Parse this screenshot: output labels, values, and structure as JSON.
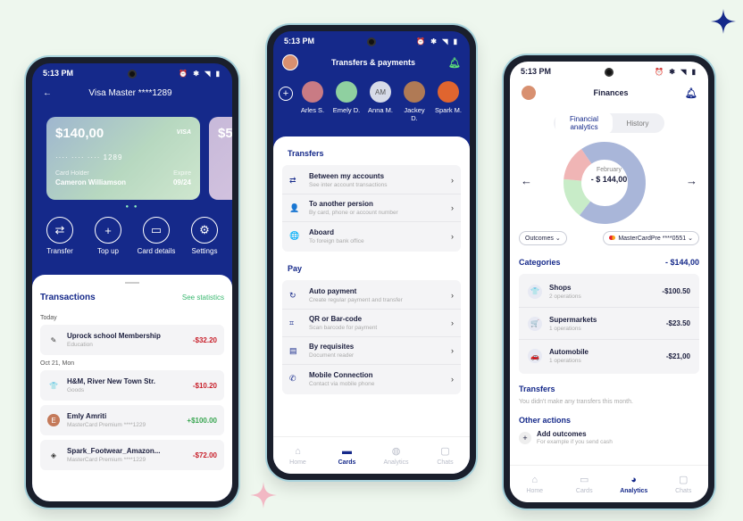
{
  "colors": {
    "accent": "#15298a",
    "positive": "#3aa652",
    "negative": "#c8202b",
    "background": "#eef7ee"
  },
  "phone1": {
    "status_time": "5:13 PM",
    "header_title": "Visa Master ****1289",
    "card": {
      "balance": "$140,00",
      "brand": "VISA",
      "number": "····  ····  ····  1289",
      "holder_label": "Card Holder",
      "holder": "Cameron Williamson",
      "expire_label": "Expire",
      "expire": "09/24"
    },
    "card2_partial": "$5",
    "actions": [
      {
        "label": "Transfer",
        "icon": "transfer-icon",
        "glyph": "⇄"
      },
      {
        "label": "Top up",
        "icon": "plus-icon",
        "glyph": "+"
      },
      {
        "label": "Card details",
        "icon": "card-icon",
        "glyph": "▭"
      },
      {
        "label": "Settings",
        "icon": "gear-icon",
        "glyph": "⚙"
      }
    ],
    "transactions_title": "Transactions",
    "see_statistics": "See statistics",
    "groups": [
      {
        "date": "Today",
        "items": [
          {
            "name": "Uprock school Membership",
            "sub": "Education",
            "amount": "-$32.20",
            "glyph": "✎"
          }
        ]
      },
      {
        "date": "Oct 21, Mon",
        "items": [
          {
            "name": "H&M, River New Town Str.",
            "sub": "Goods",
            "amount": "-$10.20",
            "glyph": "👕"
          },
          {
            "name": "Emly Amriti",
            "sub": "MasterCard Premium ****1229",
            "amount": "+$100.00",
            "glyph": "E"
          },
          {
            "name": "Spark_Footwear_Amazon...",
            "sub": "MasterCard Premium ****1229",
            "amount": "-$72.00",
            "glyph": "◈"
          }
        ]
      }
    ]
  },
  "phone2": {
    "status_time": "5:13 PM",
    "header_title": "Transfers & payments",
    "contacts": [
      {
        "name": "Arles S.",
        "color": "#c97b84",
        "initials": ""
      },
      {
        "name": "Emely D.",
        "color": "#8fd0a0",
        "initials": ""
      },
      {
        "name": "Anna M.",
        "color": "#d7dbe8",
        "initials": "AM"
      },
      {
        "name": "Jackey D.",
        "color": "#b07a55",
        "initials": ""
      },
      {
        "name": "Spark M.",
        "color": "#e0652f",
        "initials": ""
      }
    ],
    "transfers_title": "Transfers",
    "transfers": [
      {
        "name": "Between my accounts",
        "sub": "See inter account transactions",
        "glyph": "⇄"
      },
      {
        "name": "To another persion",
        "sub": "By card, phone or account number",
        "glyph": "👤"
      },
      {
        "name": "Aboard",
        "sub": "To foreign bank office",
        "glyph": "🌐"
      }
    ],
    "pay_title": "Pay",
    "pay": [
      {
        "name": "Auto payment",
        "sub": "Create regular payment and transfer",
        "glyph": "↻"
      },
      {
        "name": "QR or Bar-code",
        "sub": "Scan barcode for payment",
        "glyph": "⌗"
      },
      {
        "name": "By requisites",
        "sub": "Document reader",
        "glyph": "▤"
      },
      {
        "name": "Mobile Connection",
        "sub": "Contact via mobile phone",
        "glyph": "✆"
      }
    ],
    "tabs": [
      {
        "label": "Home",
        "glyph": "⌂"
      },
      {
        "label": "Cards",
        "glyph": "▬",
        "active": true
      },
      {
        "label": "Analytics",
        "glyph": "◍"
      },
      {
        "label": "Chats",
        "glyph": "▢"
      }
    ]
  },
  "phone3": {
    "status_time": "5:13 PM",
    "header_title": "Finances",
    "segments": [
      "Financial analytics",
      "History"
    ],
    "month": "February",
    "total": "- $ 144,00",
    "donut": [
      {
        "label": "Shops",
        "share": 0.7,
        "color": "#a9b6d9"
      },
      {
        "label": "Supermarkets",
        "share": 0.16,
        "color": "#c8ecc8"
      },
      {
        "label": "Automobile",
        "share": 0.14,
        "color": "#f0b5b5"
      }
    ],
    "filter_left": "Outcomes",
    "filter_right": "MasterCardPre ****0551",
    "categories_title": "Categories",
    "categories_total": "- $144,00",
    "categories": [
      {
        "name": "Shops",
        "sub": "2 operations",
        "amount": "-$100.50",
        "glyph": "👕"
      },
      {
        "name": "Supermarkets",
        "sub": "1 operations",
        "amount": "-$23.50",
        "glyph": "🛒"
      },
      {
        "name": "Automobile",
        "sub": "1 operations",
        "amount": "-$21,00",
        "glyph": "🚗"
      }
    ],
    "transfers_title": "Transfers",
    "transfers_note": "You didn't make any transfers this month.",
    "other_title": "Other actions",
    "add_outcomes": "Add outcomes",
    "add_outcomes_sub": "For example if you send cash",
    "tabs": [
      {
        "label": "Home",
        "glyph": "⌂"
      },
      {
        "label": "Cards",
        "glyph": "▭"
      },
      {
        "label": "Analytics",
        "glyph": "◕",
        "active": true
      },
      {
        "label": "Chats",
        "glyph": "▢"
      }
    ]
  }
}
